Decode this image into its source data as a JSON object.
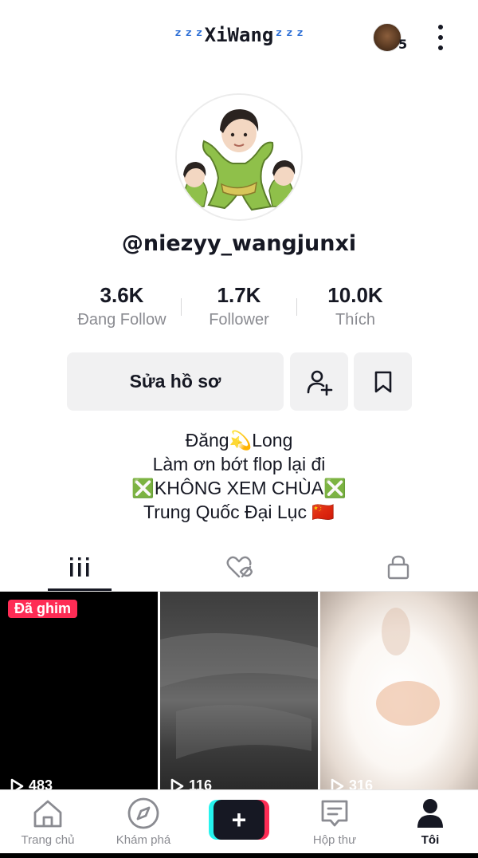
{
  "header": {
    "title_left_deco": "ᶻᶻᶻ",
    "title_text": "XiWang",
    "title_right_deco": "ᶻᶻᶻ",
    "story_count": "5"
  },
  "profile": {
    "username": "@niezyy_wangjunxi",
    "stats": [
      {
        "value": "3.6K",
        "label": "Đang Follow"
      },
      {
        "value": "1.7K",
        "label": "Follower"
      },
      {
        "value": "10.0K",
        "label": "Thích"
      }
    ],
    "edit_button_label": "Sửa hồ sơ",
    "bio": [
      "Đăng💫Long",
      "Làm ơn bớt flop lại đi",
      "❎KHÔNG XEM CHÙA❎",
      "Trung Quốc Đại Lục 🇨🇳"
    ]
  },
  "tabs": [
    {
      "icon": "grid-icon",
      "active": true
    },
    {
      "icon": "liked-hidden-icon",
      "active": false
    },
    {
      "icon": "lock-icon",
      "active": false
    }
  ],
  "videos": [
    {
      "pinned_label": "Đã ghim",
      "views": "483"
    },
    {
      "views": "116"
    },
    {
      "views": "316"
    }
  ],
  "bottom_nav": [
    {
      "label": "Trang chủ",
      "icon": "home-icon"
    },
    {
      "label": "Khám phá",
      "icon": "compass-icon"
    },
    {
      "label": "",
      "icon": "plus-icon"
    },
    {
      "label": "Hộp thư",
      "icon": "inbox-icon"
    },
    {
      "label": "Tôi",
      "icon": "profile-icon",
      "active": true
    }
  ],
  "colors": {
    "accent_pink": "#fe2c55",
    "accent_cyan": "#25f4ee",
    "text_primary": "#161823",
    "text_secondary": "#8a8b91",
    "button_bg": "#f1f1f2"
  }
}
